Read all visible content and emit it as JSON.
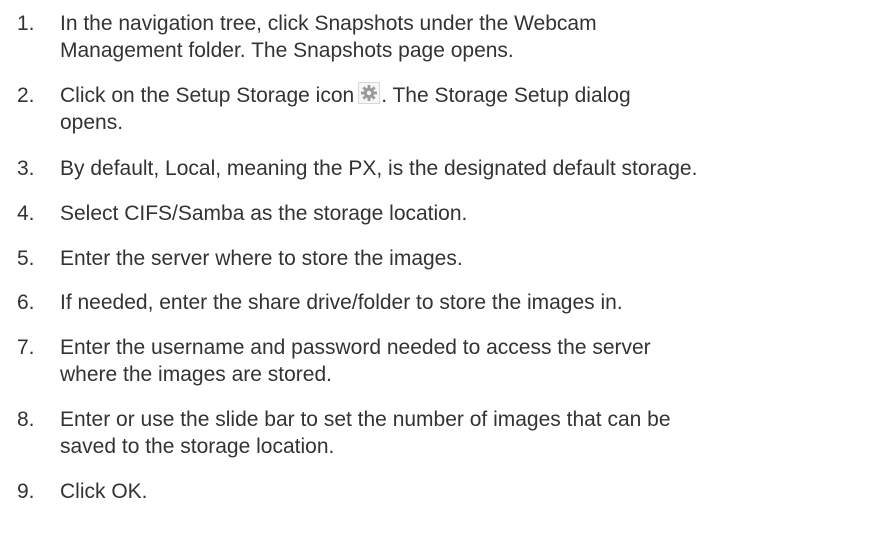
{
  "steps": [
    {
      "number": "1.",
      "lines": [
        "In the navigation tree, click Snapshots under the Webcam",
        "Management folder. The Snapshots page opens."
      ]
    },
    {
      "number": "2.",
      "before_icon": "Click on the Setup Storage icon",
      "after_icon": ". The Storage Setup dialog",
      "line2": "opens.",
      "icon": "setup-storage-gear-icon"
    },
    {
      "number": "3.",
      "lines": [
        "By default, Local, meaning the PX, is the designated default storage."
      ]
    },
    {
      "number": "4.",
      "lines": [
        "Select CIFS/Samba as the storage location."
      ]
    },
    {
      "number": "5.",
      "lines": [
        "Enter the server where to store the images."
      ]
    },
    {
      "number": "6.",
      "lines": [
        "If needed, enter the share drive/folder to store the images in."
      ]
    },
    {
      "number": "7.",
      "lines": [
        "Enter the username and password needed to access the server",
        "where the images are stored."
      ]
    },
    {
      "number": "8.",
      "lines": [
        "Enter or use the slide bar to set the number of images that can be",
        "saved to the storage location."
      ]
    },
    {
      "number": "9.",
      "lines": [
        "Click OK."
      ]
    }
  ]
}
